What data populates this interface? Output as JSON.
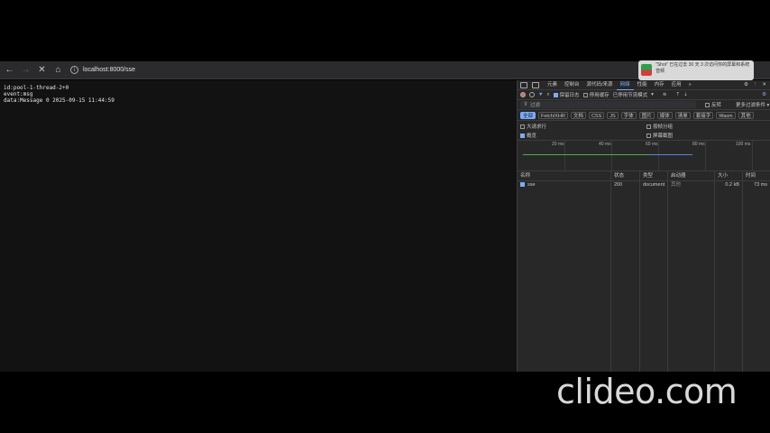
{
  "browser": {
    "back_icon": "arrow-left-icon",
    "forward_icon": "arrow-right-icon",
    "stop_icon": "close-icon",
    "home_icon": "home-icon",
    "url": "localhost:8000/sse"
  },
  "notification": {
    "text": "\"Shot\" 已在过去 30 天 3 次访问你的屏幕和系统音频"
  },
  "page": {
    "content": "id:pool-1-thread-2+0\nevent:msg\ndata:Message 0 2025-09-15 11:44:59"
  },
  "devtools": {
    "tabs": [
      "元素",
      "控制台",
      "源代码/来源",
      "网络",
      "性能",
      "内存",
      "应用"
    ],
    "active_tab": "网络",
    "more_tabs": "»",
    "toolbar": {
      "preserve_log": "保留日志",
      "disable_cache": "停用缓存",
      "throttle": "已停用节流模式"
    },
    "filter": {
      "placeholder": "过滤",
      "invert": "反转",
      "more_filters": "更多过滤条件"
    },
    "types": [
      "全部",
      "Fetch/XHR",
      "文档",
      "CSS",
      "JS",
      "字体",
      "图片",
      "媒体",
      "清单",
      "套接字",
      "Wasm",
      "其他"
    ],
    "options": {
      "big_rows": "大请求行",
      "group_by_frame": "按帧分组",
      "overview": "概览",
      "screenshots": "屏幕截图"
    },
    "timeline_ticks": [
      "20 ms",
      "40 ms",
      "60 ms",
      "80 ms",
      "100 ms"
    ],
    "columns": {
      "name": "名称",
      "status": "状态",
      "type": "类型",
      "initiator": "启动器",
      "size": "大小",
      "time": "时间"
    },
    "rows": [
      {
        "name": "sse",
        "status": "200",
        "type": "document",
        "initiator": "其他",
        "size": "0.2 kB",
        "time": "73 ms"
      }
    ]
  },
  "watermark": "clideo.com",
  "colors": {
    "accent": "#7cacf8",
    "record": "#e46962",
    "timeline_green": "#4caf50",
    "timeline_blue": "#5c85d6"
  }
}
